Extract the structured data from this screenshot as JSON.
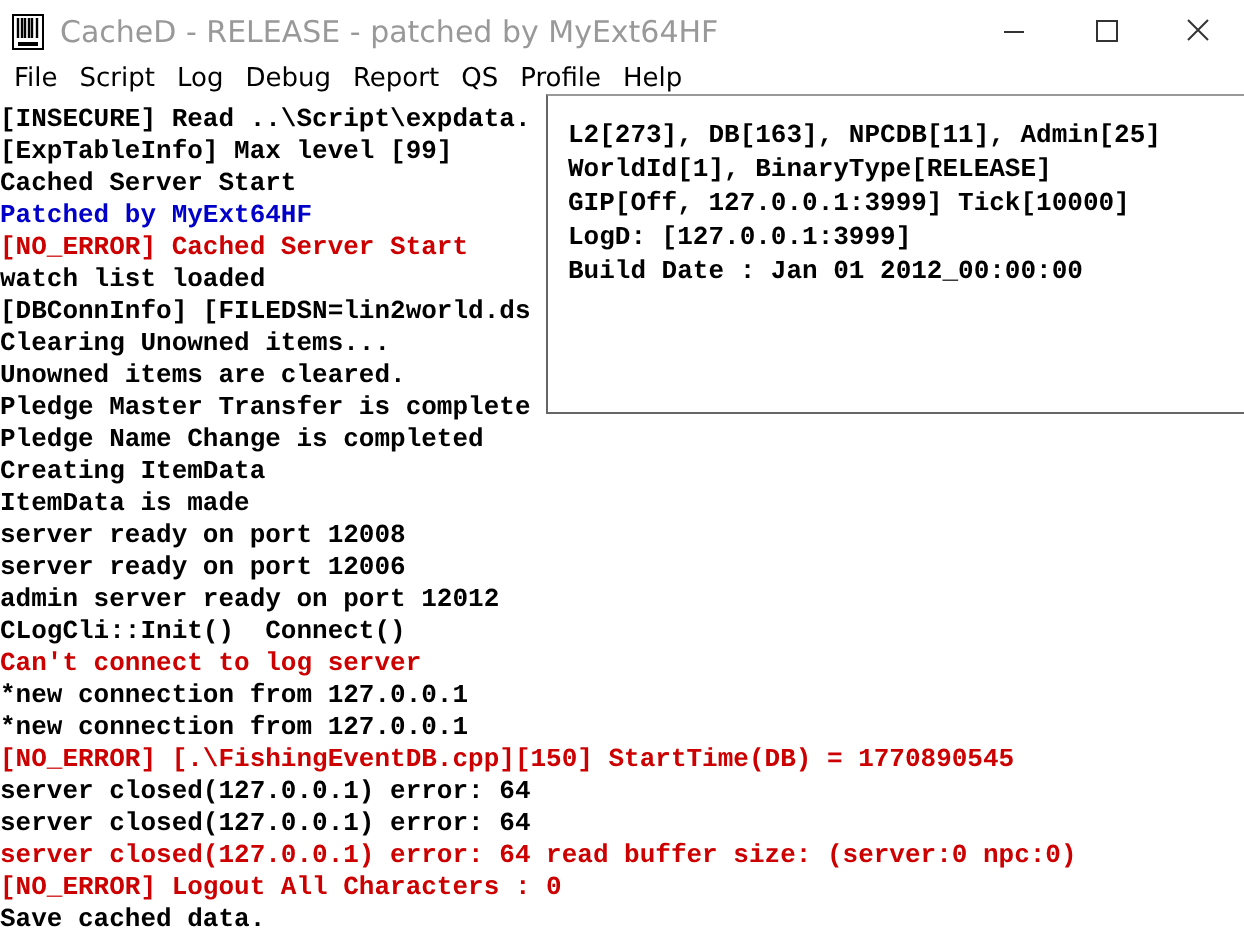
{
  "window": {
    "title": "CacheD - RELEASE - patched by MyExt64HF"
  },
  "menu": [
    "File",
    "Script",
    "Log",
    "Debug",
    "Report",
    "QS",
    "Profile",
    "Help"
  ],
  "log": [
    {
      "text": "[INSECURE] Read ..\\Script\\expdata.",
      "kind": "normal"
    },
    {
      "text": "[ExpTableInfo] Max level [99]",
      "kind": "normal"
    },
    {
      "text": "Cached Server Start",
      "kind": "normal"
    },
    {
      "text": "Patched by MyExt64HF",
      "kind": "notice"
    },
    {
      "text": "[NO_ERROR] Cached Server Start",
      "kind": "error"
    },
    {
      "text": "watch list loaded",
      "kind": "normal"
    },
    {
      "text": "[DBConnInfo] [FILEDSN=lin2world.ds",
      "kind": "normal"
    },
    {
      "text": "Clearing Unowned items...",
      "kind": "normal"
    },
    {
      "text": "Unowned items are cleared.",
      "kind": "normal"
    },
    {
      "text": "Pledge Master Transfer is complete",
      "kind": "normal"
    },
    {
      "text": "Pledge Name Change is completed",
      "kind": "normal"
    },
    {
      "text": "Creating ItemData",
      "kind": "normal"
    },
    {
      "text": "ItemData is made",
      "kind": "normal"
    },
    {
      "text": "server ready on port 12008",
      "kind": "normal"
    },
    {
      "text": "server ready on port 12006",
      "kind": "normal"
    },
    {
      "text": "admin server ready on port 12012",
      "kind": "normal"
    },
    {
      "text": "CLogCli::Init()  Connect()",
      "kind": "normal"
    },
    {
      "text": "Can't connect to log server",
      "kind": "error"
    },
    {
      "text": "*new connection from 127.0.0.1",
      "kind": "normal"
    },
    {
      "text": "*new connection from 127.0.0.1",
      "kind": "normal"
    },
    {
      "text": "[NO_ERROR] [.\\FishingEventDB.cpp][150] StartTime(DB) = 1770890545",
      "kind": "error"
    },
    {
      "text": "server closed(127.0.0.1) error: 64",
      "kind": "normal"
    },
    {
      "text": "server closed(127.0.0.1) error: 64",
      "kind": "normal"
    },
    {
      "text": "server closed(127.0.0.1) error: 64 read buffer size: (server:0 npc:0)",
      "kind": "error"
    },
    {
      "text": "[NO_ERROR] Logout All Characters : 0",
      "kind": "error"
    },
    {
      "text": "Save cached data.",
      "kind": "normal"
    }
  ],
  "info_panel": [
    "L2[273], DB[163], NPCDB[11], Admin[25]",
    "WorldId[1], BinaryType[RELEASE]",
    "GIP[Off, 127.0.0.1:3999] Tick[10000]",
    "LogD: [127.0.0.1:3999]",
    "Build Date : Jan 01 2012_00:00:00"
  ]
}
